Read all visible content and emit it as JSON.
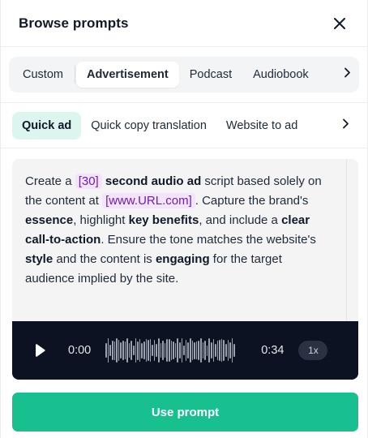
{
  "header": {
    "title": "Browse prompts",
    "close_icon": "close-icon"
  },
  "tabs": {
    "items": [
      {
        "label": "Custom",
        "active": false
      },
      {
        "label": "Advertisement",
        "active": true
      },
      {
        "label": "Podcast",
        "active": false
      },
      {
        "label": "Audiobook",
        "active": false
      }
    ],
    "more_icon": "chevron-right-icon"
  },
  "subtabs": {
    "items": [
      {
        "label": "Quick ad",
        "active": true
      },
      {
        "label": "Quick copy translation",
        "active": false
      },
      {
        "label": "Website to ad",
        "active": false
      }
    ],
    "more_icon": "chevron-right-icon"
  },
  "prompt": {
    "t1": "Create a ",
    "v1": "[30]",
    "b1": "second audio ad",
    "t2": " script based solely on the content at ",
    "v2": "[www.URL.com]",
    "t3": ". Capture the brand's ",
    "b2": "essence",
    "t4": ", highlight ",
    "b3": "key benefits",
    "t5": ", and include a ",
    "b4": "clear call-to-action",
    "t6": ". Ensure the tone matches the website's ",
    "b5": "style",
    "t7": " and the content is ",
    "b6": "engaging",
    "t8": " for the target audience implied by the site."
  },
  "player": {
    "current_time": "0:00",
    "duration": "0:34",
    "speed": "1x",
    "progress": 0
  },
  "actions": {
    "use_prompt": "Use prompt"
  },
  "colors": {
    "accent": "#17c08e",
    "active_subtab_bg": "#dcf5ee",
    "variable_bg": "#f3e3fb",
    "variable_text": "#6b21a8",
    "player_bg": "#0d1222"
  }
}
